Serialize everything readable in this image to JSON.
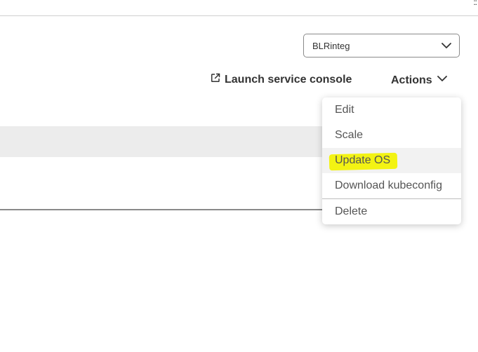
{
  "corner_marks": "::",
  "cluster_select": {
    "value": "BLRinteg",
    "icon": "chevron-down-icon"
  },
  "toolbar": {
    "launch_label": "Launch service console",
    "launch_icon": "external-link-icon",
    "actions_label": "Actions",
    "actions_icon": "chevron-down-icon"
  },
  "actions_menu": {
    "items": [
      {
        "label": "Edit"
      },
      {
        "label": "Scale"
      },
      {
        "label": "Update OS"
      },
      {
        "label": "Download kubeconfig"
      },
      {
        "label": "Delete"
      }
    ]
  },
  "colors": {
    "highlight": "#f3f313",
    "text": "#333333",
    "menu_text": "#555555"
  }
}
